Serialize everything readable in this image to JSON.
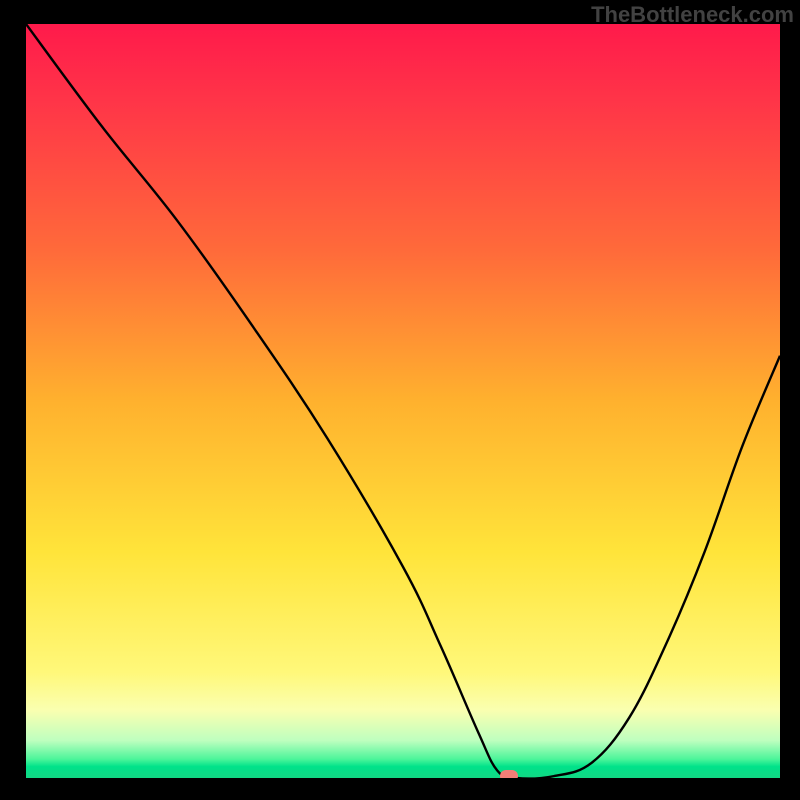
{
  "watermark": "TheBottleneck.com",
  "chart_data": {
    "type": "line",
    "title": "",
    "xlabel": "",
    "ylabel": "",
    "xlim": [
      0,
      100
    ],
    "ylim": [
      0,
      100
    ],
    "grid": false,
    "legend": false,
    "series": [
      {
        "name": "curve",
        "x": [
          0,
          10,
          20,
          30,
          40,
          50,
          55,
          60,
          62.5,
          65,
          70,
          75,
          80,
          85,
          90,
          95,
          100
        ],
        "values": [
          100,
          86.5,
          74,
          60,
          45,
          28,
          17.5,
          6,
          1,
          0,
          0.25,
          2,
          8,
          18,
          30,
          44,
          56
        ]
      }
    ],
    "marker": {
      "x": 64,
      "y": 0
    },
    "background_bands": [
      {
        "color": "#ff1a4b",
        "stop": 0
      },
      {
        "color": "#ffb12e",
        "stop": 50
      },
      {
        "color": "#fff87a",
        "stop": 86
      },
      {
        "color": "#00e28a",
        "stop": 100
      }
    ]
  }
}
